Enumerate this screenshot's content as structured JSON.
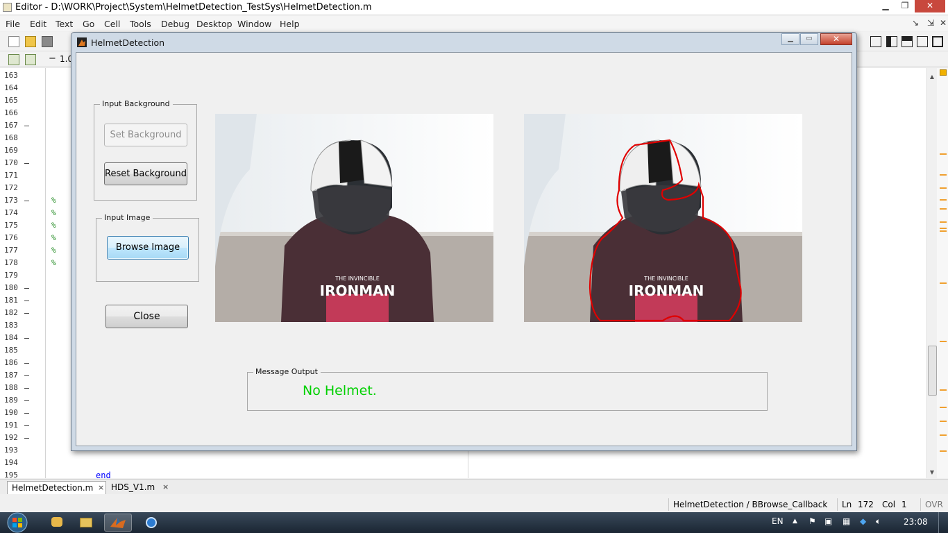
{
  "editor": {
    "title": "Editor - D:\\WORK\\Project\\System\\HelmetDetection_TestSys\\HelmetDetection.m",
    "menus": [
      "File",
      "Edit",
      "Text",
      "Go",
      "Cell",
      "Tools",
      "Debug",
      "Desktop",
      "Window",
      "Help"
    ],
    "zoom_value": "1.0",
    "line_numbers": [
      "163",
      "164",
      "165",
      "166",
      "167",
      "168",
      "169",
      "170",
      "171",
      "172",
      "173",
      "174",
      "175",
      "176",
      "177",
      "178",
      "179",
      "180",
      "181",
      "182",
      "183",
      "184",
      "185",
      "186",
      "187",
      "188",
      "189",
      "190",
      "191",
      "192",
      "193",
      "194",
      "195"
    ],
    "comment_char": "%",
    "end_keyword": "end",
    "tabs": [
      {
        "label": "HelmetDetection.m",
        "close": "×"
      },
      {
        "label": "HDS_V1.m",
        "close": "×"
      }
    ],
    "status": {
      "function": "HelmetDetection / BBrowse_Callback",
      "ln_label": "Ln",
      "ln_value": "172",
      "col_label": "Col",
      "col_value": "1",
      "mode": "OVR"
    }
  },
  "figure": {
    "title": "HelmetDetection",
    "panel_background": {
      "title": "Input Background",
      "set_button": "Set Background",
      "reset_button": "Reset Background"
    },
    "panel_image": {
      "title": "Input Image",
      "browse_button": "Browse Image"
    },
    "close_button": "Close",
    "image_left_text": "THE INVINCIBLE IRON MAN",
    "image_right_text": "THE INVINCIBLE IRON MAN",
    "message_panel": {
      "title": "Message Output",
      "message": "No Helmet.",
      "message_color": "#00d000"
    }
  },
  "taskbar": {
    "language": "EN",
    "time": "23:08"
  },
  "colors": {
    "outline_red": "#e00000",
    "accent": "#3c7fb1"
  }
}
